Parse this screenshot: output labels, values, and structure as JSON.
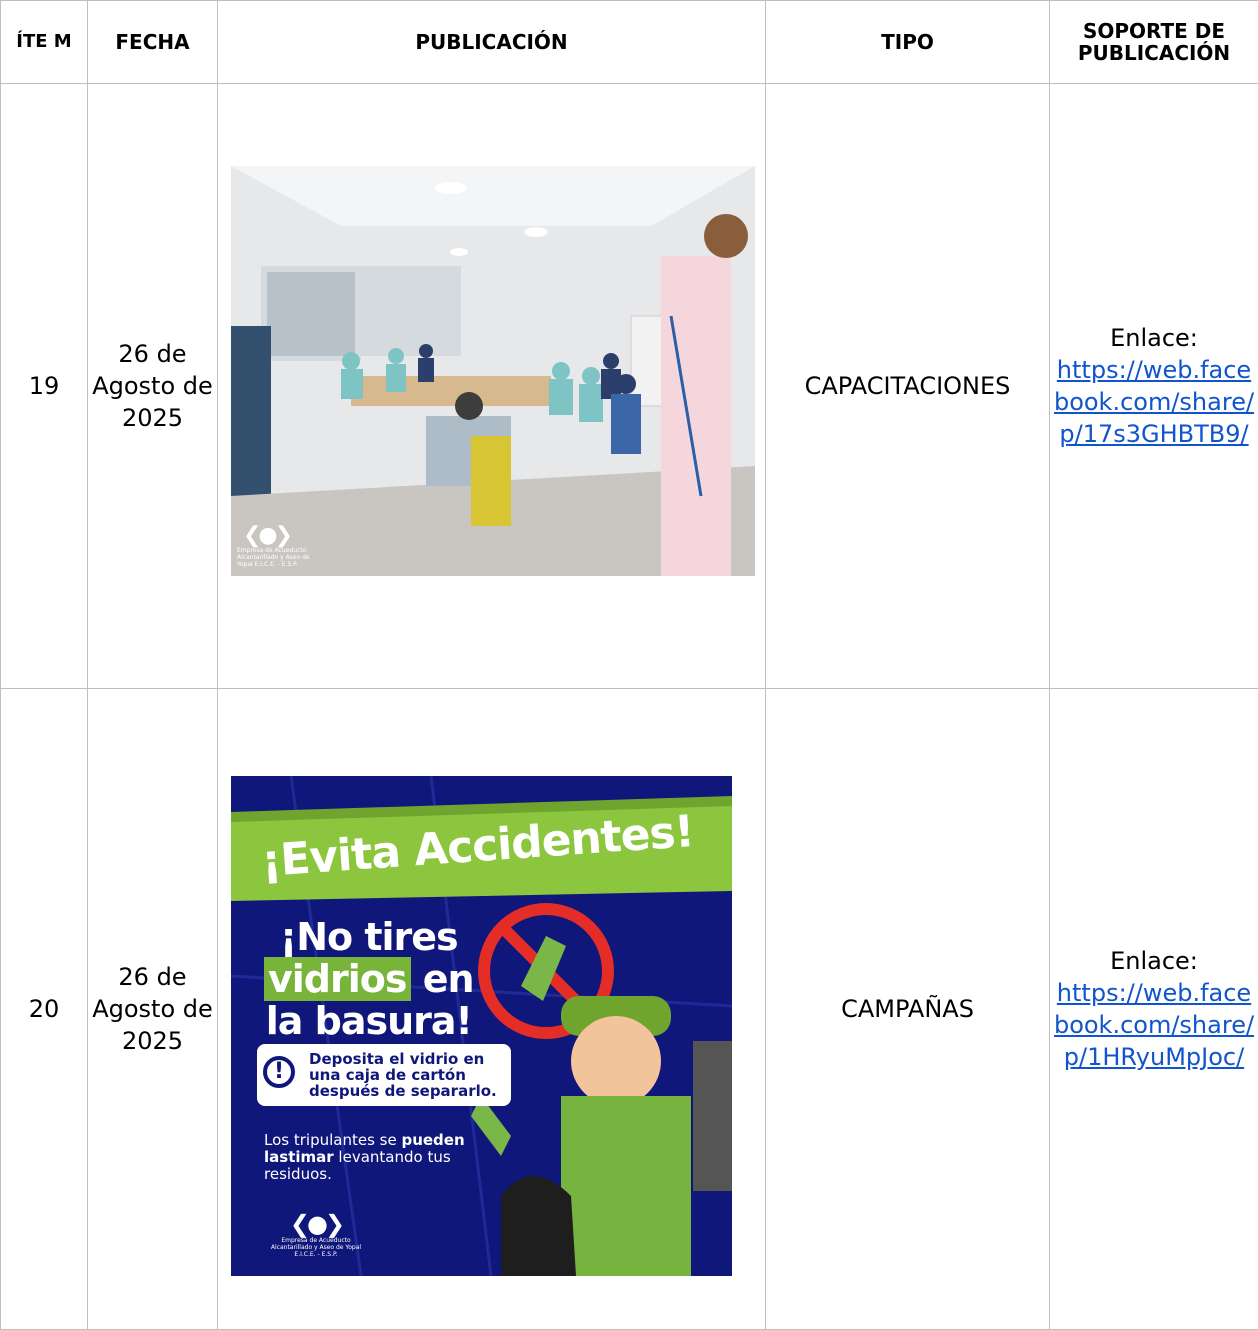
{
  "headers": {
    "item": "ÍTE M",
    "fecha": "FECHA",
    "publicacion": "PUBLICACIÓN",
    "tipo": "TIPO",
    "soporte": "SOPORTE DE PUBLICACIÓN"
  },
  "rows": [
    {
      "item": "19",
      "fecha": "26 de Agosto de 2025",
      "tipo": "CAPACITACIONES",
      "soporte_label": "Enlace:",
      "soporte_link": "https://web.facebook.com/share/p/17s3GHBTB9/",
      "image_logo_text": "Empresa de Acueducto Alcantarillado y Aseo de Yopal E.I.C.E. - E.S.P."
    },
    {
      "item": "20",
      "fecha": "26 de Agosto de 2025",
      "tipo": "CAMPAÑAS",
      "soporte_label": "Enlace:",
      "soporte_link": "https://web.facebook.com/share/p/1HRyuMpJoc/",
      "poster": {
        "title": "¡Evita Accidentes!",
        "line1": "¡No tires",
        "line2_hl": "vidrios",
        "line2_rest": " en",
        "line3": "la basura!",
        "box_text": "Deposita el vidrio en una caja de cartón después de separarlo.",
        "small_a": "Los tripulantes se ",
        "small_b": "pueden lastimar",
        "small_c": " levantando tus residuos.",
        "logo_text": "Empresa de Acueducto Alcantarillado y Aseo de Yopal E.I.C.E. - E.S.P."
      }
    }
  ],
  "colors": {
    "border": "#bfbfbf",
    "link": "#1155cc",
    "poster_bg": "#10177a",
    "poster_green": "#78b33a"
  }
}
